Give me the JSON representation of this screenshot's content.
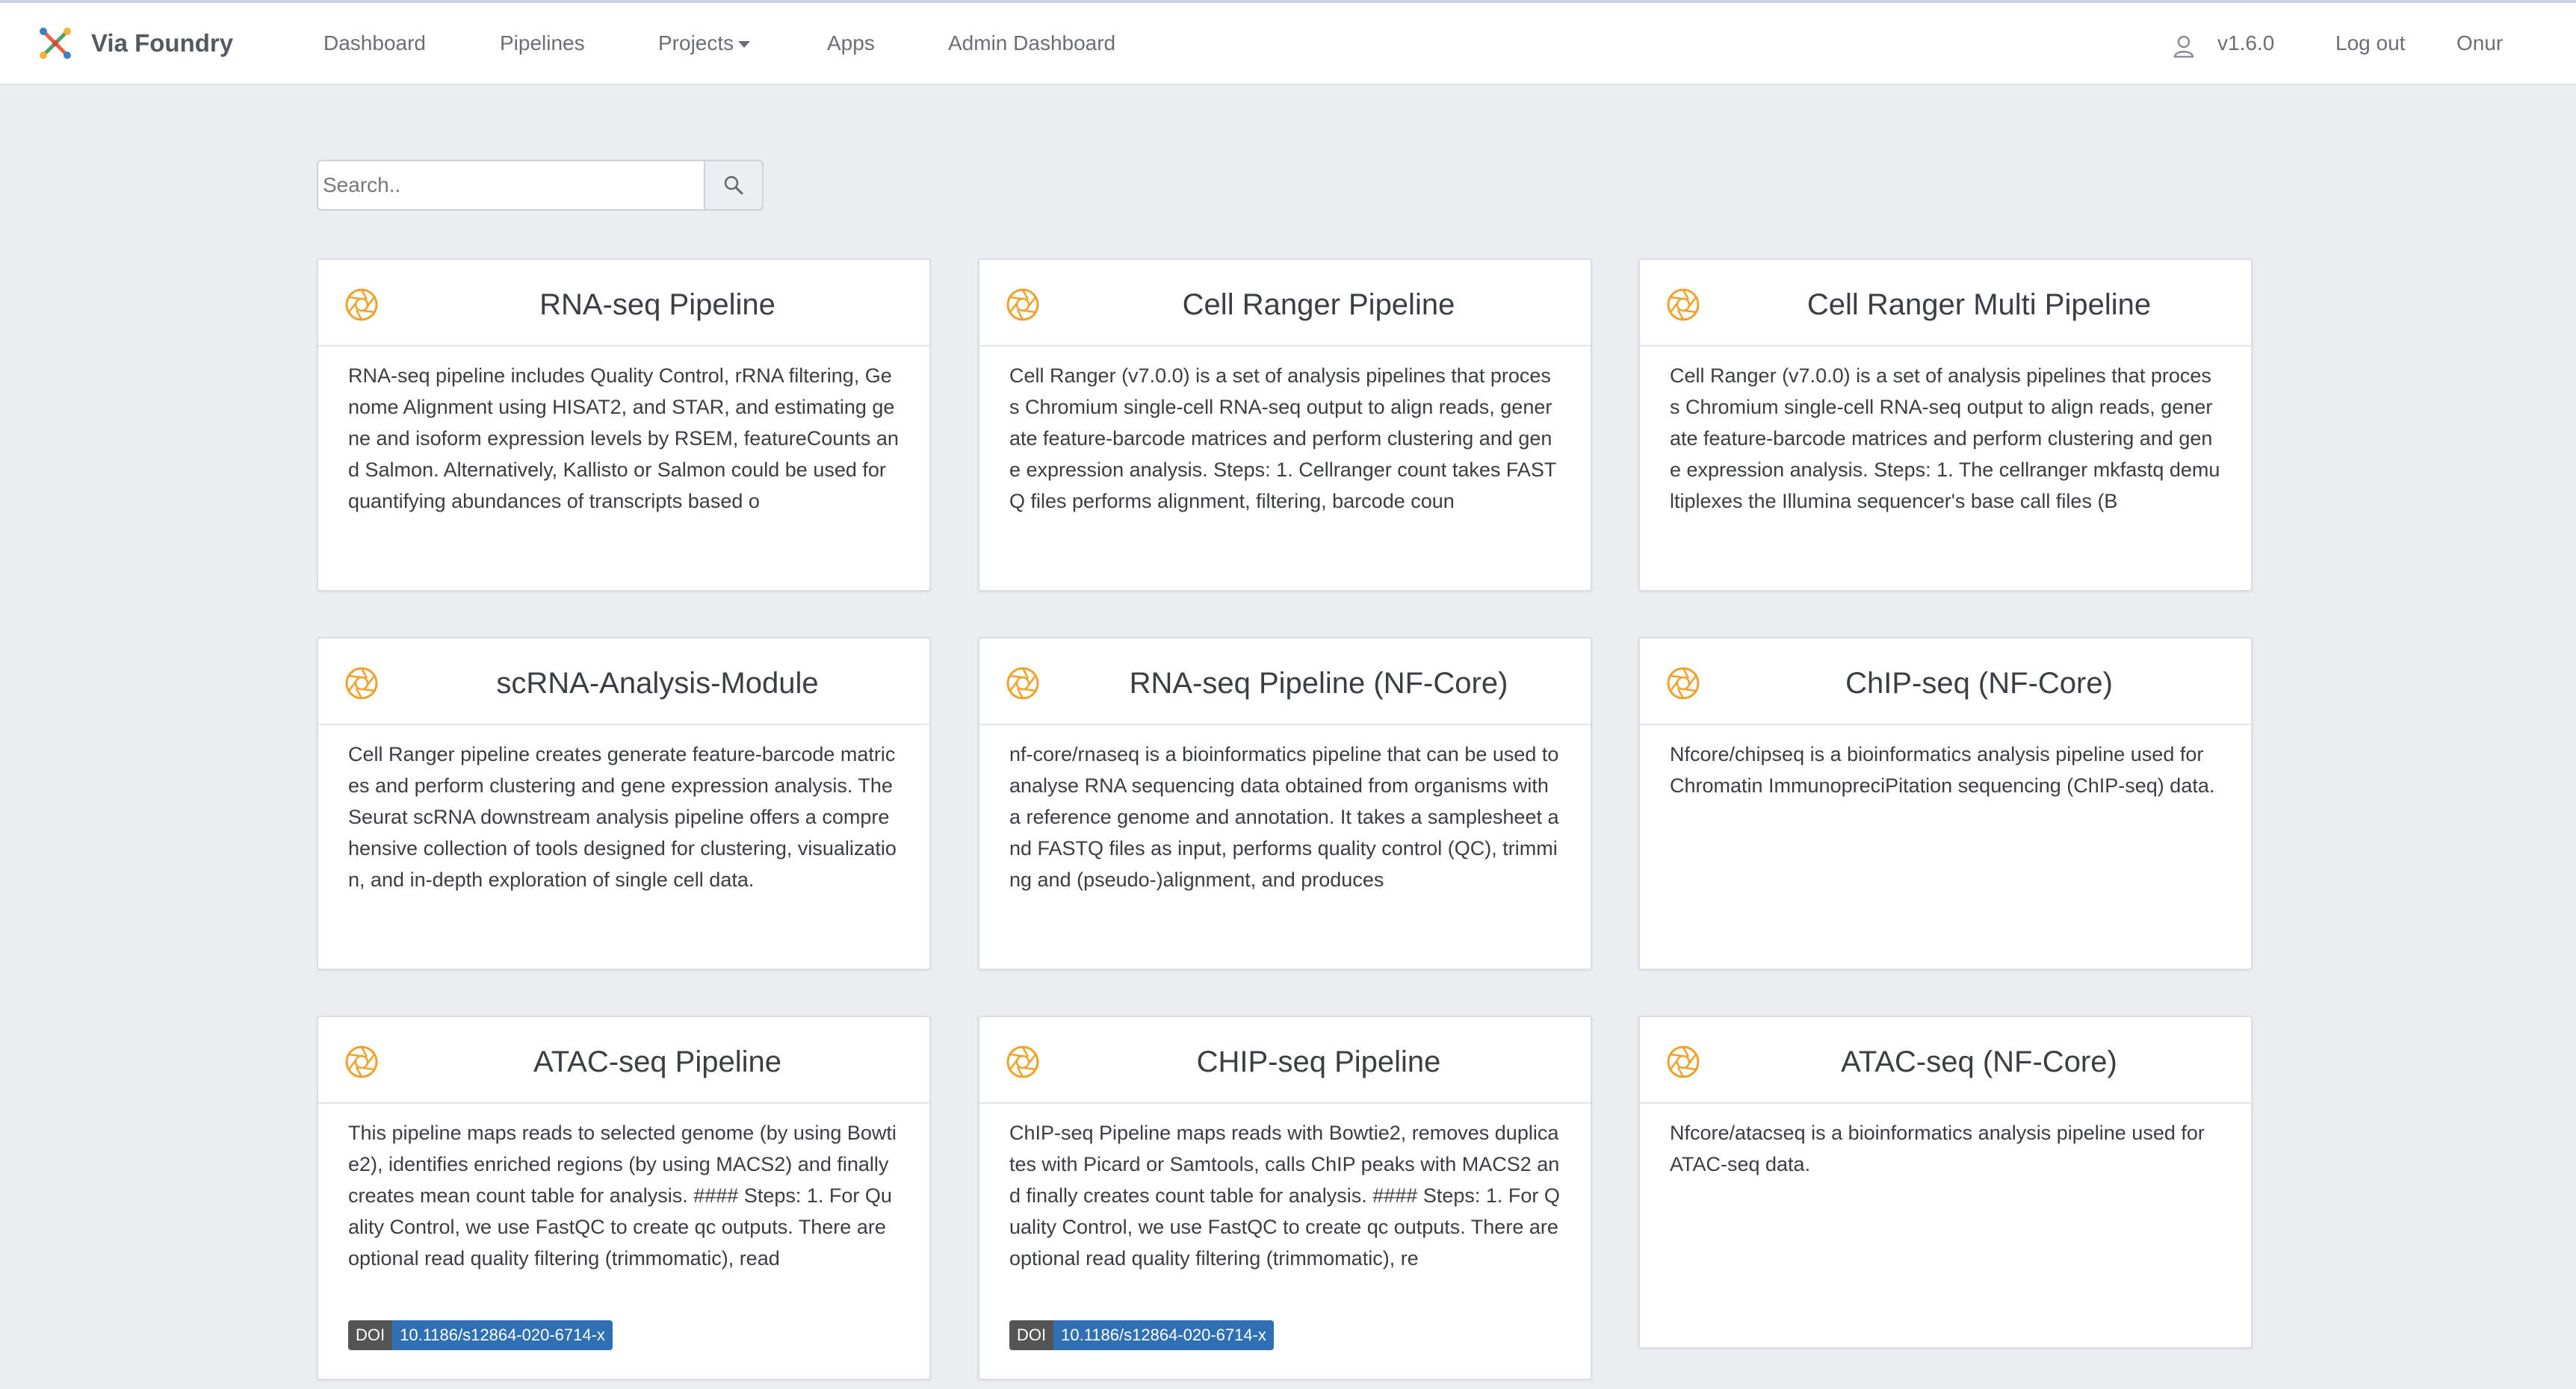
{
  "nav": {
    "brand": "Via Foundry",
    "links": [
      "Dashboard",
      "Pipelines",
      "Projects",
      "Apps",
      "Admin Dashboard"
    ],
    "version": "v1.6.0",
    "logout": "Log out",
    "user": "Onur"
  },
  "search": {
    "placeholder": "Search..",
    "icon": "search-icon"
  },
  "colors": {
    "accent_icon": "#f0a12a",
    "doi_blue": "#2f6fb3",
    "doi_gray": "#555555"
  },
  "cards": [
    {
      "title": "RNA-seq Pipeline",
      "desc": "RNA-seq pipeline includes Quality Control, rRNA filtering, Genome Alignment using HISAT2, and STAR, and estimating gene and isoform expression levels by RSEM, featureCounts and Salmon. Alternatively, Kallisto or Salmon could be used for quantifying abundances of transcripts based o"
    },
    {
      "title": "Cell Ranger Pipeline",
      "desc": "Cell Ranger (v7.0.0) is a set of analysis pipelines that process Chromium single-cell RNA-seq output to align reads, generate feature-barcode matrices and perform clustering and gene expression analysis. Steps: 1. Cellranger count takes FASTQ files performs alignment, filtering, barcode coun"
    },
    {
      "title": "Cell Ranger Multi Pipeline",
      "desc": "Cell Ranger (v7.0.0) is a set of analysis pipelines that process Chromium single-cell RNA-seq output to align reads, generate feature-barcode matrices and perform clustering and gene expression analysis. Steps: 1. The cellranger mkfastq demultiplexes the Illumina sequencer's base call files (B"
    },
    {
      "title": "scRNA-Analysis-Module",
      "desc": "Cell Ranger pipeline creates generate feature-barcode matrices and perform clustering and gene expression analysis. The Seurat scRNA downstream analysis pipeline offers a comprehensive collection of tools designed for clustering, visualization, and in-depth exploration of single cell data."
    },
    {
      "title": "RNA-seq Pipeline (NF-Core)",
      "desc": "nf-core/rnaseq is a bioinformatics pipeline that can be used to analyse RNA sequencing data obtained from organisms with a reference genome and annotation. It takes a samplesheet and FASTQ files as input, performs quality control (QC), trimming and (pseudo-)alignment, and produces"
    },
    {
      "title": "ChIP-seq (NF-Core)",
      "desc": "Nfcore/chipseq is a bioinformatics analysis pipeline used for Chromatin ImmunopreciPitation sequencing (ChIP-seq) data."
    },
    {
      "title": "ATAC-seq Pipeline",
      "desc": "This pipeline maps reads to selected genome (by using Bowtie2), identifies enriched regions (by using MACS2) and finally creates mean count table for analysis. #### Steps: 1. For Quality Control, we use FastQC to create qc outputs. There are optional read quality filtering (trimmomatic), read",
      "doi_label": "DOI",
      "doi": "10.1186/s12864-020-6714-x"
    },
    {
      "title": "CHIP-seq Pipeline",
      "desc": "ChIP-seq Pipeline maps reads with Bowtie2, removes duplicates with Picard or Samtools, calls ChIP peaks with MACS2 and finally creates count table for analysis. #### Steps: 1. For Quality Control, we use FastQC to create qc outputs. There are optional read quality filtering (trimmomatic), re",
      "doi_label": "DOI",
      "doi": "10.1186/s12864-020-6714-x"
    },
    {
      "title": "ATAC-seq (NF-Core)",
      "desc": "Nfcore/atacseq is a bioinformatics analysis pipeline used for ATAC-seq data."
    }
  ]
}
